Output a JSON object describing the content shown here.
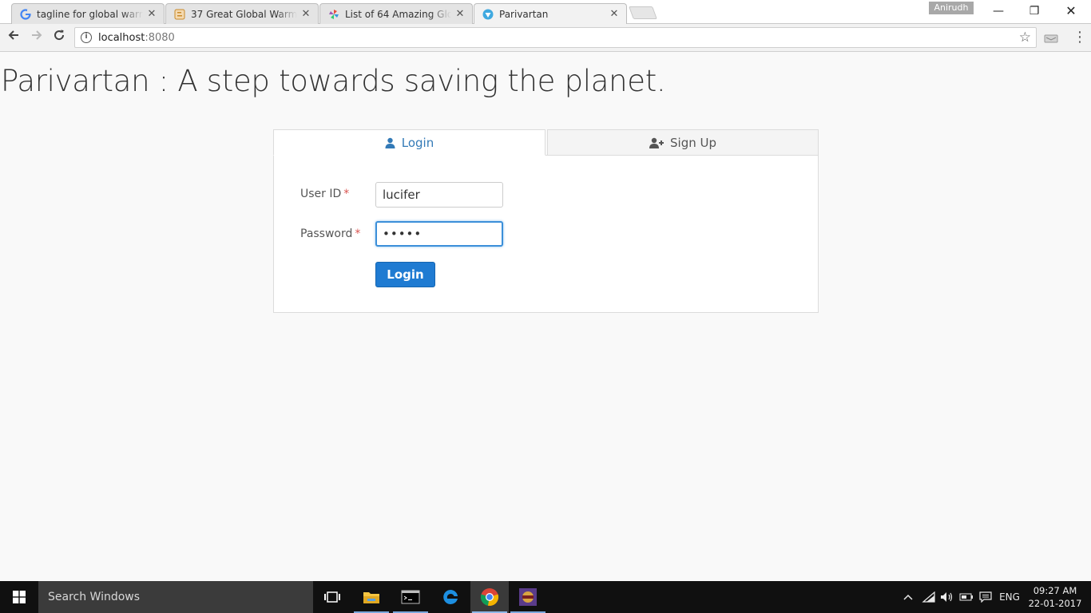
{
  "browser": {
    "tabs": [
      {
        "title": "tagline for global warmin",
        "favicon": "google-icon"
      },
      {
        "title": "37 Great Global Warming",
        "favicon": "blogger-icon"
      },
      {
        "title": "List of 64 Amazing Globa",
        "favicon": "pinwheel-icon"
      },
      {
        "title": "Parivartan",
        "favicon": "parivartan-icon",
        "active": true
      }
    ],
    "profile_name": "Anirudh",
    "address": {
      "host": "localhost",
      "port": ":8080"
    }
  },
  "page": {
    "title": "Parivartan : A step towards saving the planet.",
    "tabs": {
      "login": "Login",
      "signup": "Sign Up"
    },
    "form": {
      "userid_label": "User ID",
      "password_label": "Password",
      "required_mark": "*",
      "userid_value": "lucifer",
      "password_value": "•••••",
      "submit_label": "Login"
    },
    "colors": {
      "accent": "#337ab7",
      "button": "#1f7bd2",
      "required": "#d9534f"
    }
  },
  "taskbar": {
    "search_placeholder": "Search Windows",
    "language": "ENG",
    "time": "09:27 AM",
    "date": "22-01-2017",
    "apps": [
      "task-view-icon",
      "file-explorer-icon",
      "terminal-icon",
      "edge-icon",
      "chrome-icon",
      "game-icon"
    ]
  }
}
